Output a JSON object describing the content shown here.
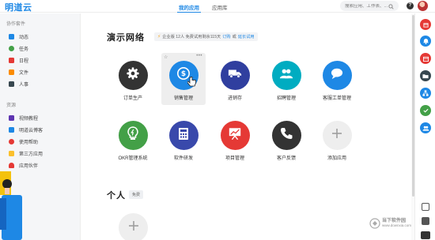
{
  "header": {
    "logo": "明道云",
    "tabs": [
      {
        "label": "我的应用",
        "active": true
      },
      {
        "label": "应用库",
        "active": false
      }
    ],
    "search_placeholder": "搜索应用、工作表、...",
    "help_label": "?"
  },
  "sidebar": {
    "section1_title": "协作套件",
    "items1": [
      {
        "label": "动态",
        "icon": "feed-icon",
        "color": "#1e88e5"
      },
      {
        "label": "任务",
        "icon": "task-icon",
        "color": "#43a047"
      },
      {
        "label": "日程",
        "icon": "calendar-icon",
        "color": "#e53935"
      },
      {
        "label": "文件",
        "icon": "folder-icon",
        "color": "#fb8c00"
      },
      {
        "label": "人事",
        "icon": "people-icon",
        "color": "#37474f"
      }
    ],
    "section2_title": "资源",
    "items2": [
      {
        "label": "视频教程",
        "icon": "video-icon",
        "color": "#5e35b1"
      },
      {
        "label": "明道云博客",
        "icon": "blog-icon",
        "color": "#1e88e5"
      },
      {
        "label": "使用帮助",
        "icon": "help-icon",
        "color": "#e53935"
      },
      {
        "label": "第三方应用",
        "icon": "puzzle-icon",
        "color": "#fbc02d"
      },
      {
        "label": "应用伙伴",
        "icon": "heart-icon",
        "color": "#e53935"
      }
    ]
  },
  "workspace": {
    "title": "演示网络",
    "edition_text": "企业版 12人 免费试用剩余115天",
    "order_link": "订购",
    "or_text": "或",
    "extend_link": "延长试用"
  },
  "apps": [
    {
      "label": "订单生产",
      "icon": "gear-icon",
      "color": "#333333",
      "selected": false
    },
    {
      "label": "销售管理",
      "icon": "coin-icon",
      "color": "#1e88e5",
      "selected": true
    },
    {
      "label": "进销存",
      "icon": "truck-icon",
      "color": "#303f9f",
      "selected": false
    },
    {
      "label": "招聘管理",
      "icon": "people-icon",
      "color": "#00acc1",
      "selected": false
    },
    {
      "label": "客服工单管理",
      "icon": "chat-icon",
      "color": "#1e88e5",
      "selected": false
    },
    {
      "label": "OKR管理系统",
      "icon": "bulb-icon",
      "color": "#43a047",
      "selected": false
    },
    {
      "label": "软件研发",
      "icon": "calculator-icon",
      "color": "#3949ab",
      "selected": false
    },
    {
      "label": "项目管理",
      "icon": "presentation-icon",
      "color": "#e53935",
      "selected": false
    },
    {
      "label": "客户反馈",
      "icon": "phone-icon",
      "color": "#333333",
      "selected": false
    },
    {
      "label": "添加应用",
      "icon": "plus-icon",
      "color": "#eeeeee",
      "selected": false
    }
  ],
  "personal": {
    "title": "个人",
    "badge": "免费"
  },
  "dock": {
    "buttons": [
      {
        "icon": "box-icon",
        "color": "#e53935"
      },
      {
        "icon": "bell-icon",
        "color": "#1e88e5"
      },
      {
        "icon": "calendar-icon",
        "color": "#e53935"
      },
      {
        "icon": "folder-icon",
        "color": "#37474f"
      },
      {
        "icon": "org-icon",
        "color": "#1e88e5"
      },
      {
        "icon": "check-icon",
        "color": "#43a047"
      },
      {
        "icon": "group-icon",
        "color": "#1e88e5"
      }
    ]
  },
  "watermark": {
    "line1": "当下软件园",
    "line2": "www.downxia.com"
  }
}
